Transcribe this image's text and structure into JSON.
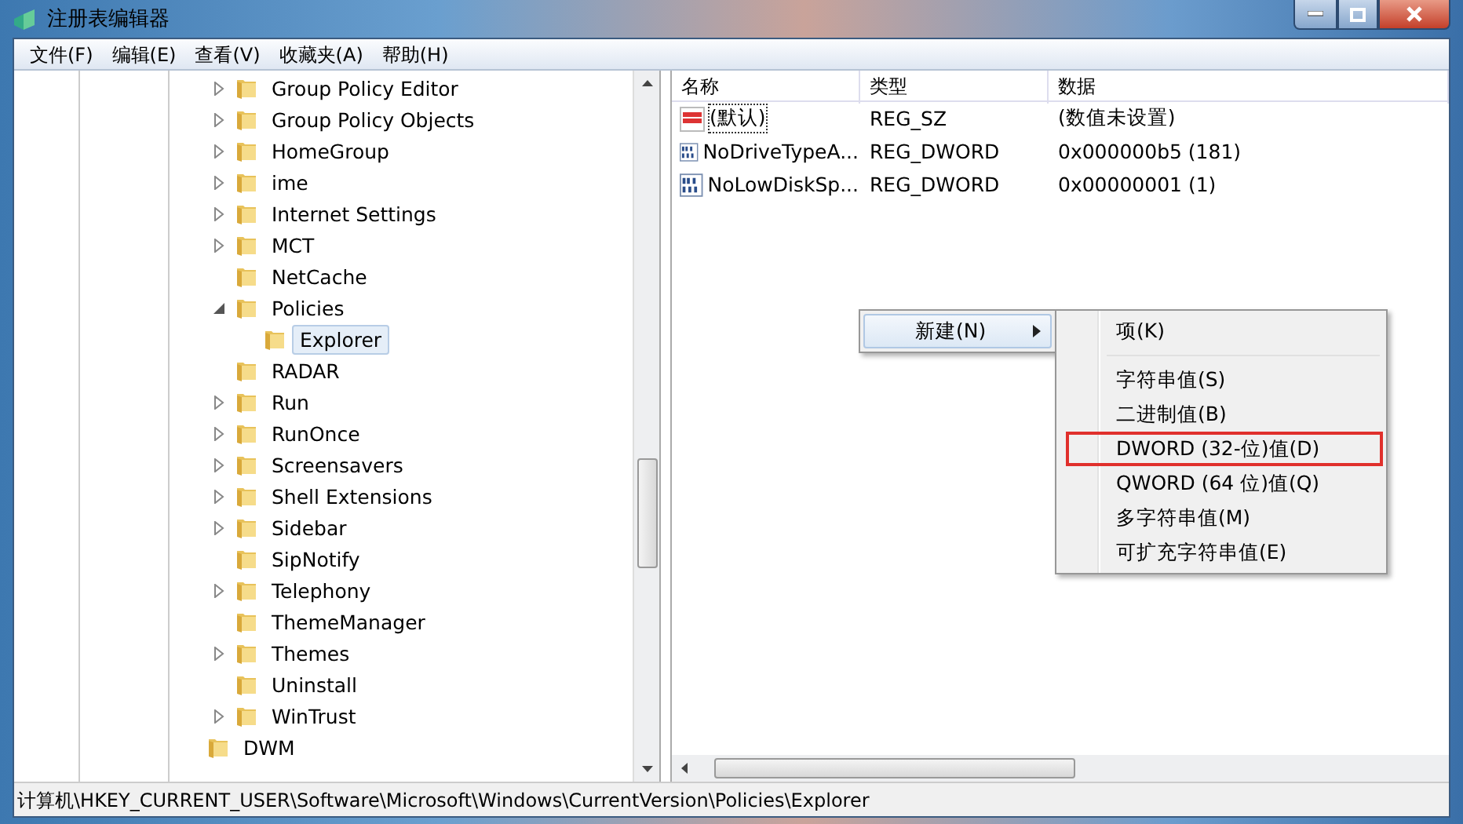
{
  "window": {
    "title": "注册表编辑器"
  },
  "menu_bar": [
    "文件(F)",
    "编辑(E)",
    "查看(V)",
    "收藏夹(A)",
    "帮助(H)"
  ],
  "tree": {
    "items": [
      {
        "label": "Group Policy Editor",
        "expandable": true,
        "expanded": false,
        "selected": false
      },
      {
        "label": "Group Policy Objects",
        "expandable": true,
        "expanded": false,
        "selected": false
      },
      {
        "label": "HomeGroup",
        "expandable": true,
        "expanded": false,
        "selected": false
      },
      {
        "label": "ime",
        "expandable": true,
        "expanded": false,
        "selected": false
      },
      {
        "label": "Internet Settings",
        "expandable": true,
        "expanded": false,
        "selected": false
      },
      {
        "label": "MCT",
        "expandable": true,
        "expanded": false,
        "selected": false
      },
      {
        "label": "NetCache",
        "expandable": false,
        "selected": false
      },
      {
        "label": "Policies",
        "expandable": true,
        "expanded": true,
        "selected": false,
        "children": [
          {
            "label": "Explorer",
            "expandable": false,
            "selected": true
          }
        ]
      },
      {
        "label": "RADAR",
        "expandable": false,
        "selected": false
      },
      {
        "label": "Run",
        "expandable": true,
        "expanded": false,
        "selected": false
      },
      {
        "label": "RunOnce",
        "expandable": true,
        "expanded": false,
        "selected": false
      },
      {
        "label": "Screensavers",
        "expandable": true,
        "expanded": false,
        "selected": false
      },
      {
        "label": "Shell Extensions",
        "expandable": true,
        "expanded": false,
        "selected": false
      },
      {
        "label": "Sidebar",
        "expandable": true,
        "expanded": false,
        "selected": false
      },
      {
        "label": "SipNotify",
        "expandable": false,
        "selected": false
      },
      {
        "label": "Telephony",
        "expandable": true,
        "expanded": false,
        "selected": false
      },
      {
        "label": "ThemeManager",
        "expandable": false,
        "selected": false
      },
      {
        "label": "Themes",
        "expandable": true,
        "expanded": false,
        "selected": false
      },
      {
        "label": "Uninstall",
        "expandable": false,
        "selected": false
      },
      {
        "label": "WinTrust",
        "expandable": true,
        "expanded": false,
        "selected": false
      }
    ],
    "parent_sibling": {
      "label": "DWM",
      "expandable": false,
      "selected": false
    }
  },
  "values": {
    "columns": [
      "名称",
      "类型",
      "数据"
    ],
    "rows": [
      {
        "kind": "string",
        "name": "(默认)",
        "type": "REG_SZ",
        "data": "(数值未设置)",
        "focused": true
      },
      {
        "kind": "binary",
        "name": "NoDriveTypeA...",
        "type": "REG_DWORD",
        "data": "0x000000b5 (181)",
        "focused": false
      },
      {
        "kind": "binary",
        "name": "NoLowDiskSp...",
        "type": "REG_DWORD",
        "data": "0x00000001 (1)",
        "focused": false
      }
    ]
  },
  "context_menu": {
    "items": [
      {
        "label": "新建(N)"
      }
    ],
    "submenu": [
      {
        "label": "项(K)",
        "highlighted": false
      },
      {
        "label": "字符串值(S)",
        "highlighted": false
      },
      {
        "label": "二进制值(B)",
        "highlighted": false
      },
      {
        "label": "DWORD (32-位)值(D)",
        "highlighted": true
      },
      {
        "label": "QWORD (64 位)值(Q)",
        "highlighted": false
      },
      {
        "label": "多字符串值(M)",
        "highlighted": false
      },
      {
        "label": "可扩充字符串值(E)",
        "highlighted": false
      }
    ]
  },
  "status_bar": "计算机\\HKEY_CURRENT_USER\\Software\\Microsoft\\Windows\\CurrentVersion\\Policies\\Explorer"
}
